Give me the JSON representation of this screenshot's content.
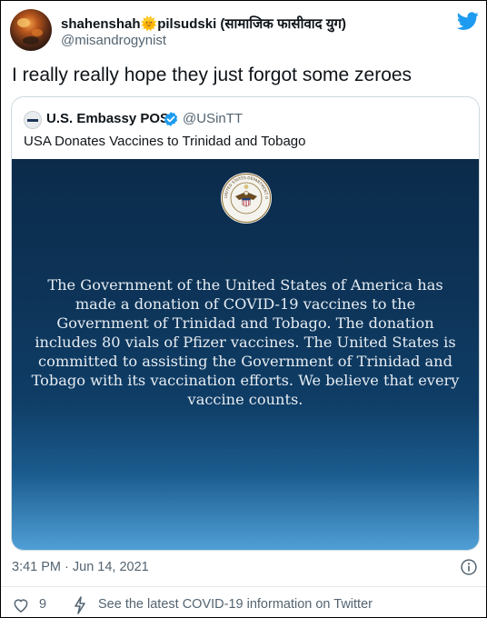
{
  "author": {
    "name": "shahenshah",
    "emoji": "🌞",
    "name_suffix": "pilsudski (सामाजिक फासीवाद युग)",
    "handle": "@misandrogynist"
  },
  "tweet": {
    "text": "I really really hope they just forgot some zeroes"
  },
  "quoted": {
    "name": "U.S. Embassy POS",
    "handle": "@USinTT",
    "text": "USA Donates Vaccines to Trinidad and Tobago",
    "image_text": "The Government of the United States of America has made a donation of COVID-19 vaccines to the Government of Trinidad and Tobago. The donation includes 80 vials of Pfizer vaccines. The United States is committed to assisting the Government of Trinidad and Tobago with its vaccination efforts. We believe that every vaccine counts.",
    "seal_text": "UNITED STATES DEPARTMENT OF STATE"
  },
  "meta": {
    "timestamp": "3:41 PM · Jun 14, 2021",
    "likes": "9",
    "covid_link": "See the latest COVID-19 information on Twitter"
  },
  "colors": {
    "twitter_blue": "#1d9bf0",
    "secondary_text": "#536471",
    "image_bg_top": "#0c2b4b",
    "image_bg_bottom": "#4f9fd6"
  },
  "icons": {
    "bird": "twitter-bird-icon",
    "verified": "verified-badge-icon",
    "info": "info-icon",
    "like": "heart-icon",
    "covid": "lightning-icon"
  }
}
